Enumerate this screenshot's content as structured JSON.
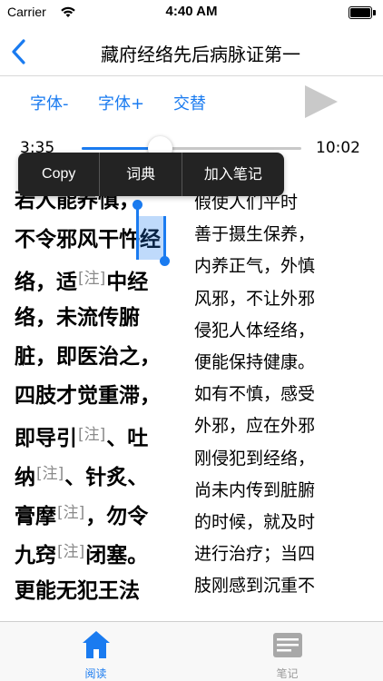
{
  "status_bar": {
    "carrier": "Carrier",
    "time": "4:40 AM"
  },
  "nav": {
    "title": "藏府经络先后病脉证第一"
  },
  "toolbar": {
    "font_smaller": "字体-",
    "font_larger": "字体+",
    "alternate": "交替"
  },
  "player": {
    "elapsed": "3:35",
    "total": "10:02",
    "progress_fraction": 0.357
  },
  "context_menu": {
    "copy": "Copy",
    "dictionary": "词典",
    "add_note": "加入笔记"
  },
  "original_text": {
    "lines": [
      "若人能养慎，",
      "不令邪风干忤经",
      "络，适",
      "络，未流传腑",
      "脏，即医治之，",
      "四肢才觉重滞，",
      "即导引",
      "纳",
      "膏摩",
      "九窍",
      "更能无犯王法"
    ],
    "segments_after_note": {
      "line_3": "中经",
      "line_7": "、吐",
      "line_8": "、针炙、",
      "line_9": "，勿令",
      "line_10": "闭塞。"
    },
    "note_marker": "[注]"
  },
  "translation": {
    "lines": [
      "假使人们平时",
      "善于摄生保养，",
      "内养正气，外慎",
      "风邪，不让外邪",
      "侵犯人体经络，",
      "便能保持健康。",
      "如有不慎，感受",
      "外邪，应在外邪",
      "刚侵犯到经络，",
      "尚未内传到脏腑",
      "的时候，就及时",
      "进行治疗；当四",
      "肢刚感到沉重不"
    ]
  },
  "tab_bar": {
    "read": "阅读",
    "notes": "笔记",
    "active": "read"
  },
  "colors": {
    "accent": "#1a7bf0",
    "menu_bg": "#232323",
    "inactive": "#9a9a9a"
  }
}
